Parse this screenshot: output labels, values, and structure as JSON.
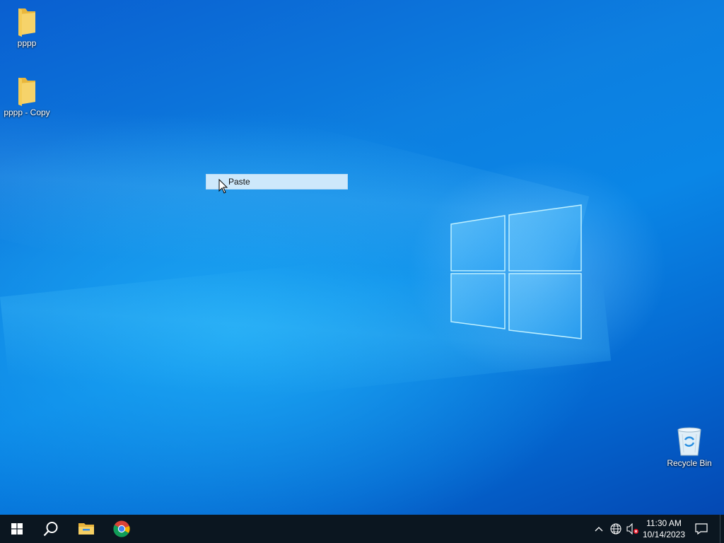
{
  "desktop": {
    "icons": [
      {
        "label": "pppp",
        "icon": "folder-icon"
      },
      {
        "label": "pppp - Copy",
        "icon": "folder-icon"
      },
      {
        "label": "Recycle Bin",
        "icon": "recycle-bin-icon"
      }
    ]
  },
  "context_menu": {
    "items": [
      {
        "label": "Paste"
      }
    ]
  },
  "taskbar": {
    "apps": [
      {
        "name": "Start",
        "icon": "windows-start-icon"
      },
      {
        "name": "Search",
        "icon": "search-icon"
      },
      {
        "name": "File Explorer",
        "icon": "file-explorer-icon"
      },
      {
        "name": "Google Chrome",
        "icon": "chrome-icon"
      }
    ],
    "tray": {
      "time": "11:30 AM",
      "date": "10/14/2023",
      "icons": [
        "chevron-up-icon",
        "network-globe-icon",
        "volume-muted-icon",
        "notification-icon"
      ]
    }
  },
  "colors": {
    "taskbar_bg": "#0b1620",
    "menu_highlight": "#cde8fb",
    "folder_yellow": "#f5cf5c"
  }
}
